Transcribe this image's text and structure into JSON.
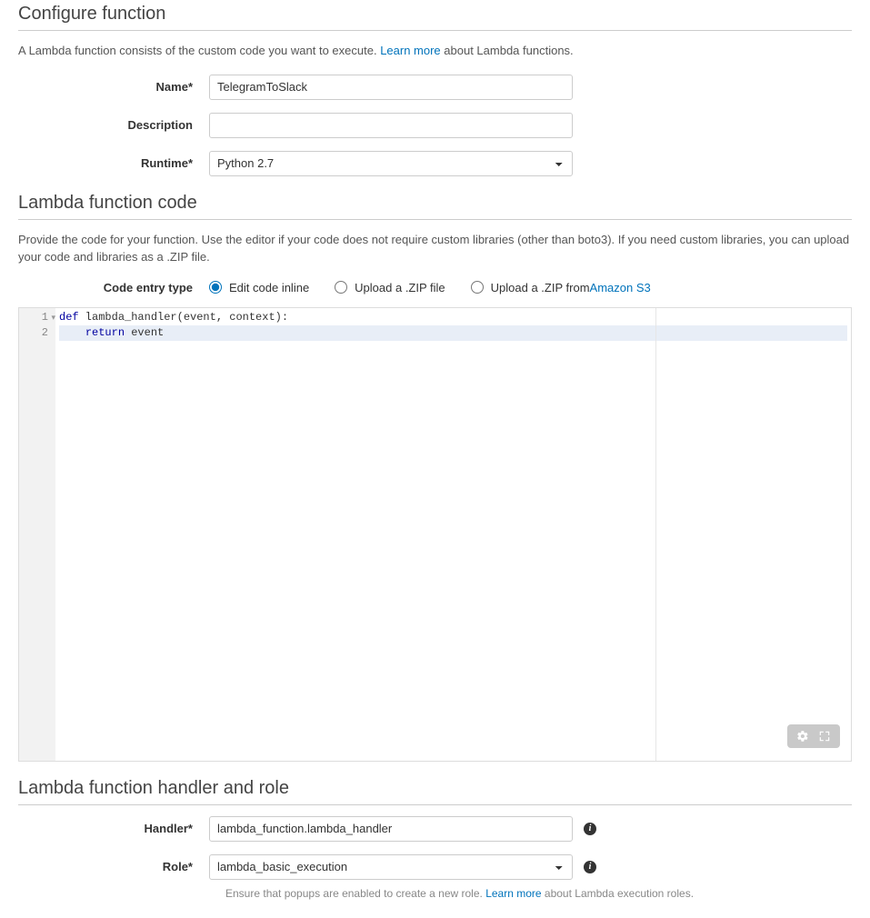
{
  "sections": {
    "configure": {
      "title": "Configure function",
      "desc_pre": "A Lambda function consists of the custom code you want to execute. ",
      "desc_link": "Learn more",
      "desc_post": " about Lambda functions."
    },
    "code": {
      "title": "Lambda function code",
      "desc": "Provide the code for your function. Use the editor if your code does not require custom libraries (other than boto3). If you need custom libraries, you can upload your code and libraries as a .ZIP file."
    },
    "handler": {
      "title": "Lambda function handler and role",
      "helper_pre": "Ensure that popups are enabled to create a new role. ",
      "helper_link": "Learn more",
      "helper_post": " about Lambda execution roles."
    }
  },
  "fields": {
    "name": {
      "label": "Name*",
      "value": "TelegramToSlack"
    },
    "description": {
      "label": "Description",
      "value": ""
    },
    "runtime": {
      "label": "Runtime*",
      "selected": "Python 2.7"
    },
    "code_entry": {
      "label": "Code entry type",
      "options": [
        "Edit code inline",
        "Upload a .ZIP file",
        "Upload a .ZIP from "
      ],
      "s3_link": "Amazon S3",
      "selected_index": 0
    },
    "handler": {
      "label": "Handler*",
      "value": "lambda_function.lambda_handler"
    },
    "role": {
      "label": "Role*",
      "selected": "lambda_basic_execution"
    }
  },
  "editor": {
    "line1_kw": "def",
    "line1_rest": " lambda_handler(event, context):",
    "line2_indent": "    ",
    "line2_kw": "return",
    "line2_rest": " event",
    "line_numbers": [
      "1",
      "2"
    ]
  }
}
